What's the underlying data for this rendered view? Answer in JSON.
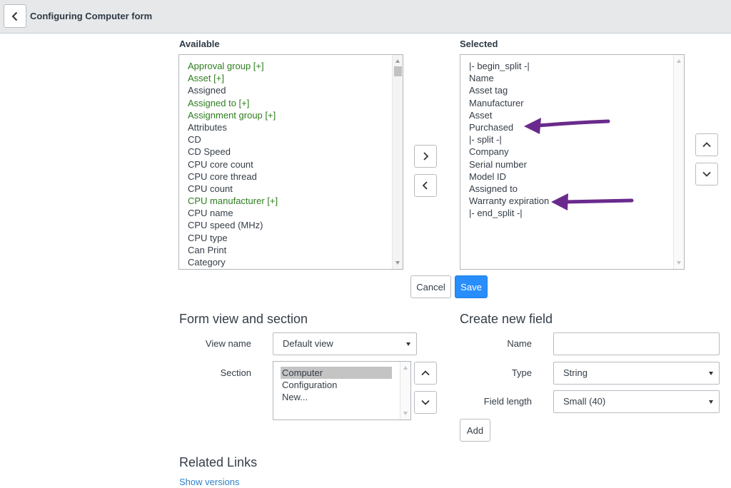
{
  "header": {
    "title": "Configuring Computer form"
  },
  "available": {
    "label": "Available",
    "items": [
      {
        "label": "Approval group [+]",
        "ref": true
      },
      {
        "label": "Asset [+]",
        "ref": true
      },
      {
        "label": "Assigned",
        "ref": false
      },
      {
        "label": "Assigned to [+]",
        "ref": true
      },
      {
        "label": "Assignment group [+]",
        "ref": true
      },
      {
        "label": "Attributes",
        "ref": false
      },
      {
        "label": "CD",
        "ref": false
      },
      {
        "label": "CD Speed",
        "ref": false
      },
      {
        "label": "CPU core count",
        "ref": false
      },
      {
        "label": "CPU core thread",
        "ref": false
      },
      {
        "label": "CPU count",
        "ref": false
      },
      {
        "label": "CPU manufacturer [+]",
        "ref": true
      },
      {
        "label": "CPU name",
        "ref": false
      },
      {
        "label": "CPU speed (MHz)",
        "ref": false
      },
      {
        "label": "CPU type",
        "ref": false
      },
      {
        "label": "Can Print",
        "ref": false
      },
      {
        "label": "Category",
        "ref": false
      }
    ]
  },
  "selected": {
    "label": "Selected",
    "items": [
      "|- begin_split -|",
      "Name",
      "Asset tag",
      "Manufacturer",
      "Asset",
      "Purchased",
      "|- split -|",
      "Company",
      "Serial number",
      "Model ID",
      "Assigned to",
      "Warranty expiration",
      "|- end_split -|"
    ]
  },
  "actions": {
    "cancel": "Cancel",
    "save": "Save"
  },
  "form_view": {
    "title": "Form view and section",
    "view_name_label": "View name",
    "view_name_value": "Default view",
    "section_label": "Section",
    "sections": [
      "Computer",
      "Configuration",
      "New..."
    ],
    "selected_section": "Computer"
  },
  "new_field": {
    "title": "Create new field",
    "name_label": "Name",
    "name_value": "",
    "type_label": "Type",
    "type_value": "String",
    "length_label": "Field length",
    "length_value": "Small (40)",
    "add_label": "Add"
  },
  "related": {
    "title": "Related Links",
    "show_versions": "Show versions"
  },
  "colors": {
    "reference_field": "#2e7d1e",
    "primary_button": "#278efc",
    "annotation_arrow": "#6a2a8c",
    "link": "#2f80c8"
  },
  "icons": {
    "back": "chevron-left-icon",
    "add": "chevron-right-icon",
    "remove": "chevron-left-icon",
    "move_up": "chevron-up-icon",
    "move_down": "chevron-down-icon"
  }
}
